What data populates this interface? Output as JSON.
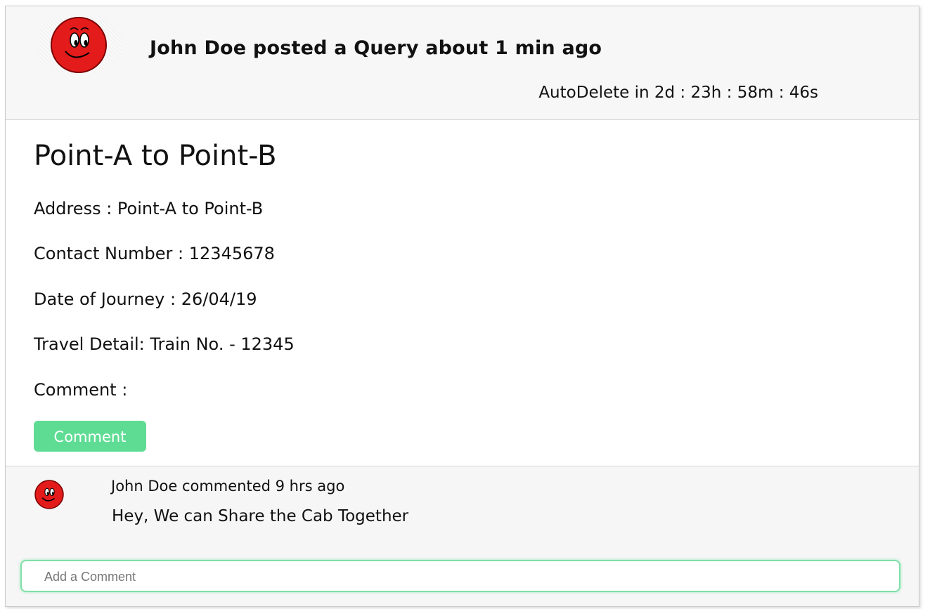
{
  "post": {
    "header_title": "John Doe posted a Query about 1 min ago",
    "auto_delete": "AutoDelete in 2d : 23h : 58m : 46s",
    "route": "Point-A to Point-B",
    "address": "Address : Point-A to Point-B",
    "contact": "Contact Number : 12345678",
    "date": "Date of Journey : 26/04/19",
    "travel": "Travel Detail: Train No. - 12345",
    "comment_label": "Comment :",
    "comment_button": "Comment"
  },
  "comments": [
    {
      "meta": "John Doe commented 9 hrs ago",
      "text": "Hey, We can Share the Cab Together"
    }
  ],
  "comment_input": {
    "placeholder": "Add a Comment",
    "value": ""
  },
  "colors": {
    "accent": "#5fdc94",
    "header_bg": "#f7f7f7",
    "avatar_red": "#e41b1b"
  },
  "icons": {
    "avatar": "smiley-face-avatar-icon"
  }
}
